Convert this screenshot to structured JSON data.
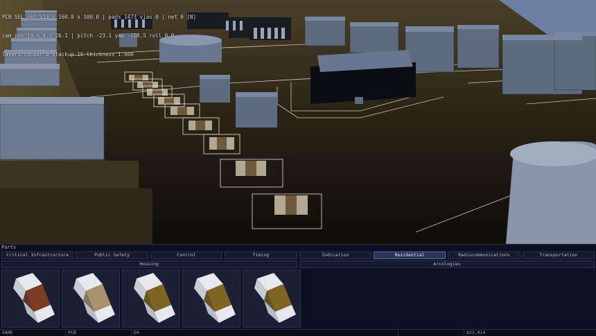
{
  "hud": {
    "line1": "PCB SEL sel U13 | 160.0 x 100.0 | pads 1473 vias 0 | net 0 [N]",
    "line2": "cam pos 19.6 4.2 26.1 | pitch -23.1 yaw -108.5 roll 0.0",
    "line3": "layers copper B stackup 16 thickness 1.600"
  },
  "panel": {
    "title": "Parts",
    "tabs": [
      {
        "label": "Critical Infrastructure",
        "active": false
      },
      {
        "label": "Public Safety",
        "active": false
      },
      {
        "label": "Control",
        "active": false
      },
      {
        "label": "Timing",
        "active": false
      },
      {
        "label": "Indication",
        "active": false
      },
      {
        "label": "Residential",
        "active": true
      },
      {
        "label": "Radiocommunications",
        "active": false
      },
      {
        "label": "Transportation",
        "active": false
      }
    ],
    "subtabs": [
      {
        "label": "Housing",
        "active": false
      },
      {
        "label": "Arcologies",
        "active": false
      }
    ],
    "parts": [
      {
        "name": "capacitor-chip-brown",
        "body": "#7a3d22",
        "cap": "#e6e8ee"
      },
      {
        "name": "capacitor-chip-tan",
        "body": "#a8926a",
        "cap": "#e6e8ee"
      },
      {
        "name": "capacitor-chip-olive-1",
        "body": "#7d6524",
        "cap": "#e6e8ee"
      },
      {
        "name": "capacitor-chip-olive-2",
        "body": "#7d6524",
        "cap": "#e6e8ee"
      },
      {
        "name": "capacitor-chip-olive-3",
        "body": "#7d6524",
        "cap": "#e6e8ee"
      }
    ]
  },
  "status": {
    "mode": "GAME",
    "board": "PCB",
    "cell": "D4",
    "blank": "",
    "money": "$23,014"
  },
  "colors": {
    "board": "#2b2417",
    "silkscreen": "#e8e4d8",
    "component": "#5e6a7e",
    "sky": "#5d7190",
    "accent": "#5a6aa0"
  }
}
